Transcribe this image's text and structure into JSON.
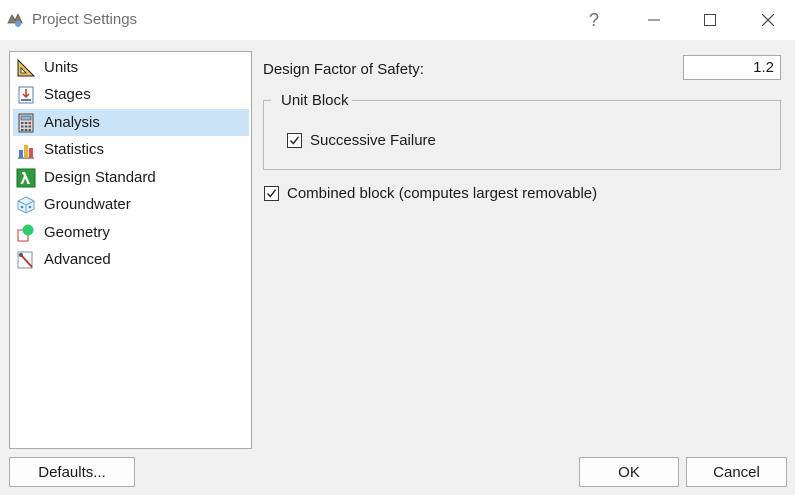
{
  "window": {
    "title": "Project Settings",
    "help_glyph": "?"
  },
  "sidebar": {
    "items": [
      {
        "label": "Units",
        "icon": "units-ruler-icon"
      },
      {
        "label": "Stages",
        "icon": "stages-icon"
      },
      {
        "label": "Analysis",
        "icon": "calculator-icon",
        "selected": true
      },
      {
        "label": "Statistics",
        "icon": "bar-chart-icon"
      },
      {
        "label": "Design Standard",
        "icon": "lambda-icon"
      },
      {
        "label": "Groundwater",
        "icon": "groundwater-cube-icon"
      },
      {
        "label": "Geometry",
        "icon": "geometry-icon"
      },
      {
        "label": "Advanced",
        "icon": "advanced-tool-icon"
      }
    ]
  },
  "main": {
    "design_fos_label": "Design Factor of Safety:",
    "design_fos_value": "1.2",
    "unit_block": {
      "title": "Unit Block",
      "successive_failure_label": "Successive Failure",
      "successive_failure_checked": true
    },
    "combined_block_label": "Combined block (computes largest removable)",
    "combined_block_checked": true
  },
  "footer": {
    "defaults_label": "Defaults...",
    "ok_label": "OK",
    "cancel_label": "Cancel"
  },
  "colors": {
    "selection": "#cce4f7",
    "window_bg": "#f0f0f0"
  }
}
